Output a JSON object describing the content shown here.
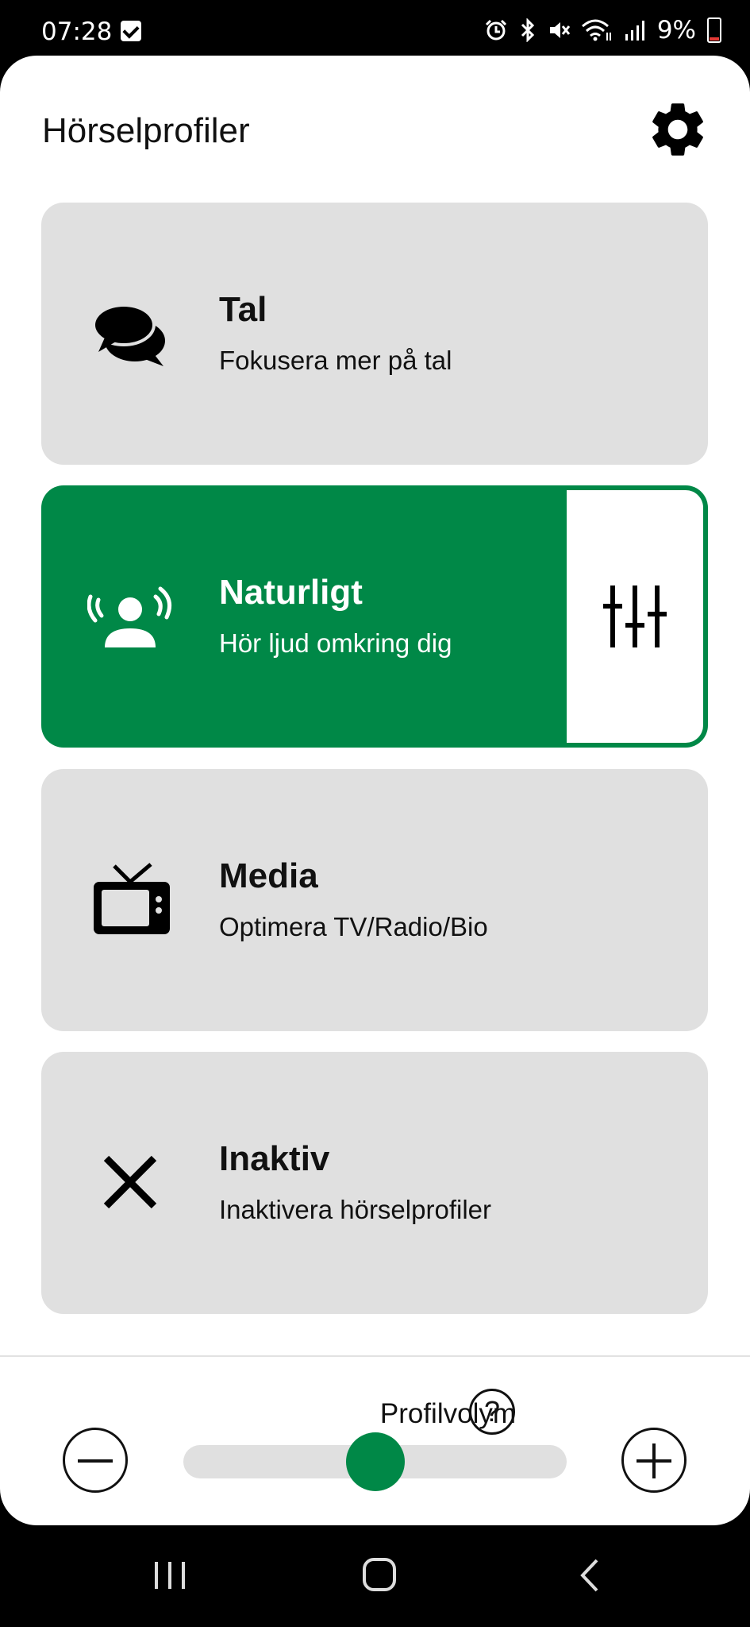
{
  "status_bar": {
    "time": "07:28",
    "battery": "9%",
    "icons": [
      "checkbox-notification-icon",
      "alarm-icon",
      "bluetooth-icon",
      "mute-icon",
      "wifi-icon",
      "signal-icon",
      "battery-icon"
    ]
  },
  "header": {
    "title": "Hörselprofiler",
    "settings_icon": "gear-icon"
  },
  "profiles": [
    {
      "name": "Tal",
      "description": "Fokusera mer på tal",
      "icon": "speech-bubbles-icon",
      "active": false
    },
    {
      "name": "Naturligt",
      "description": "Hör ljud omkring dig",
      "icon": "person-sound-icon",
      "active": true,
      "adjust_icon": "equalizer-icon"
    },
    {
      "name": "Media",
      "description": "Optimera TV/Radio/Bio",
      "icon": "tv-icon",
      "active": false
    },
    {
      "name": "Inaktiv",
      "description": "Inaktivera hörselprofiler",
      "icon": "close-icon",
      "active": false
    }
  ],
  "volume": {
    "label": "Profilvolym",
    "help": "?",
    "level": 0.5
  },
  "colors": {
    "accent": "#008847",
    "card_bg": "#e0e0e0",
    "text": "#111111"
  },
  "nav": {
    "icons": [
      "recent-apps-icon",
      "home-icon",
      "back-icon"
    ]
  }
}
